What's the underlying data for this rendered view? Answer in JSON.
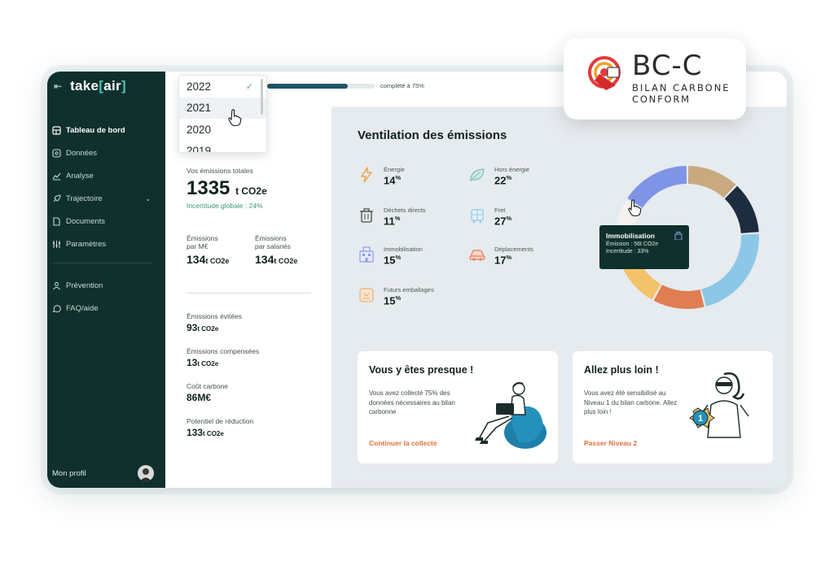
{
  "brand": {
    "logo_prefix": "take",
    "logo_bracket_open": "[",
    "logo_core": "air",
    "logo_bracket_close": "]"
  },
  "sidebar": {
    "items": [
      {
        "label": "Tableau de bord",
        "icon": "dashboard-icon",
        "active": true
      },
      {
        "label": "Données",
        "icon": "data-icon"
      },
      {
        "label": "Analyse",
        "icon": "chart-icon"
      },
      {
        "label": "Trajectoire",
        "icon": "rocket-icon",
        "has_submenu": true
      },
      {
        "label": "Documents",
        "icon": "document-icon"
      },
      {
        "label": "Paramètres",
        "icon": "settings-icon"
      },
      {
        "label": "Prévention",
        "icon": "prevention-icon"
      },
      {
        "label": "FAQ/aide",
        "icon": "help-icon"
      }
    ],
    "profile_label": "Mon profil"
  },
  "year_dropdown": {
    "options": [
      "2022",
      "2021",
      "2020",
      "2019"
    ],
    "selected": "2022",
    "hovered": "2021"
  },
  "progress": {
    "value": 0.75,
    "label": "complété à 75%"
  },
  "summary": {
    "total_label": "Vos émissions totales",
    "total_value": "1335",
    "total_unit": "t CO2e",
    "uncertainty": "Incertitude globale : 24%",
    "per_meur_label_1": "Émissions",
    "per_meur_label_2": "par M€",
    "per_meur_value": "134",
    "per_meur_unit": "t CO2e",
    "per_emp_label_1": "Émissions",
    "per_emp_label_2": "par salariés",
    "per_emp_value": "134",
    "per_emp_unit": "t CO2e",
    "avoided_label": "Émissions évitées",
    "avoided_value": "93",
    "avoided_unit": "t CO2e",
    "offset_label": "Émissions compensées",
    "offset_value": "13",
    "offset_unit": "t CO2e",
    "carbon_cost_label": "Coût carbone",
    "carbon_cost_value": "86M€",
    "reduction_label": "Potentiel de réduction",
    "reduction_value": "133",
    "reduction_unit": "t CO2e"
  },
  "ventilation": {
    "title": "Ventilation des émissions",
    "categories": [
      {
        "name": "Énergie",
        "value": "14",
        "unit": "%",
        "icon": "lightning-icon",
        "color": "#f0a24a"
      },
      {
        "name": "Hors énergie",
        "value": "22",
        "unit": "%",
        "icon": "leaf-icon",
        "color": "#7bbfb4"
      },
      {
        "name": "Déchets directs",
        "value": "11",
        "unit": "%",
        "icon": "trash-icon",
        "color": "#3e4a4a"
      },
      {
        "name": "Fret",
        "value": "27",
        "unit": "%",
        "icon": "freight-icon",
        "color": "#8cc7e8"
      },
      {
        "name": "Immobilisation",
        "value": "15",
        "unit": "%",
        "icon": "building-icon",
        "color": "#8c9be6"
      },
      {
        "name": "Déplacements",
        "value": "17",
        "unit": "%",
        "icon": "car-icon",
        "color": "#e47d5a"
      },
      {
        "name": "Futurs emballages",
        "value": "15",
        "unit": "%",
        "icon": "package-icon",
        "color": "#e8b27a"
      }
    ],
    "tooltip": {
      "title": "Immobilisation",
      "line1": "Émission : 56t CO2e",
      "line2": "Incertitude : 33%"
    }
  },
  "chart_data": {
    "type": "pie",
    "categories": [
      "Hors énergie",
      "Déchets directs",
      "Fret",
      "Déplacements",
      "Futurs emballages",
      "Énergie",
      "Immobilisation"
    ],
    "values": [
      12,
      12,
      22,
      12,
      14,
      12,
      16
    ],
    "colors": [
      "#c9a97e",
      "#1d2c3e",
      "#8cc7e8",
      "#e07d52",
      "#f2c36a",
      "#f4f2ee",
      "#7f94e6"
    ]
  },
  "cards": [
    {
      "title": "Vous y êtes presque !",
      "text": "Vous avez collecté 75% des données nécessaires au bilan carbonne",
      "link": "Continuer la collecte"
    },
    {
      "title": "Allez plus loin !",
      "text": "Vous avez été sensibilisé au Niveau 1 du bilan carbone. Allez plus loin !",
      "link": "Passer Niveau 2",
      "medal_number": "1"
    }
  ],
  "certification": {
    "title": "BC-C",
    "line1": "BILAN CARBONE",
    "line2": "CONFORM"
  }
}
